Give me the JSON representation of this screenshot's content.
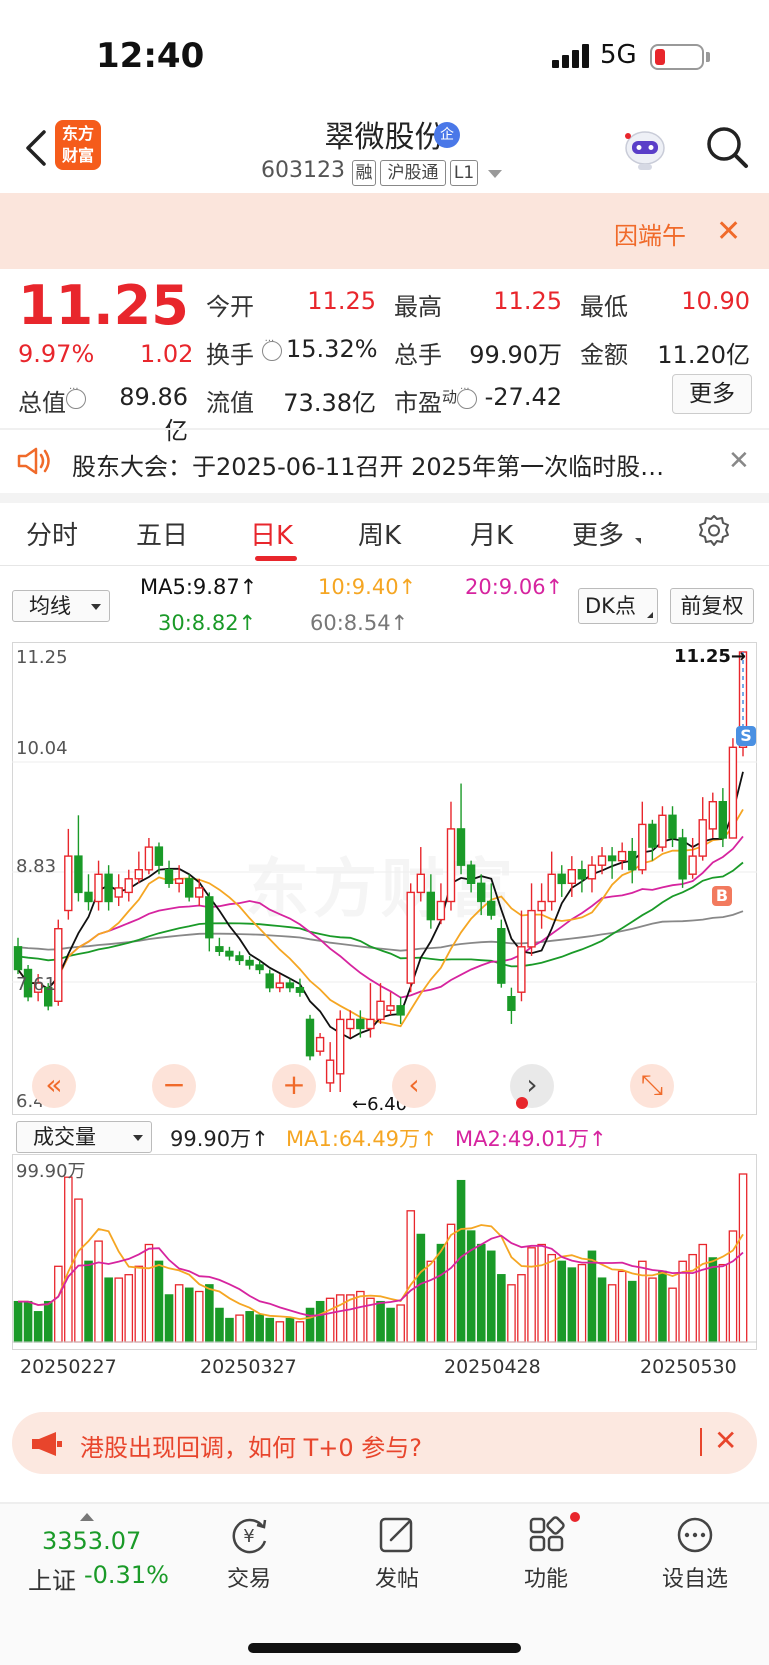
{
  "status": {
    "time": "12:40",
    "network": "5G"
  },
  "header": {
    "logo": "东方财富",
    "name": "翠微股份",
    "name_badge": "企",
    "code": "603123",
    "tags": [
      "融",
      "沪股通",
      "L1"
    ]
  },
  "banner": {
    "text": "因端午"
  },
  "quote": {
    "price": "11.25",
    "pct": "9.97%",
    "chg": "1.02",
    "open_label": "今开",
    "open": "11.25",
    "high_label": "最高",
    "high": "11.25",
    "low_label": "最低",
    "low": "10.90",
    "turnover_label": "换手",
    "turnover": "15.32%",
    "volume_label": "总手",
    "volume": "99.90万",
    "amount_label": "金额",
    "amount": "11.20亿",
    "mktcap_label": "总值",
    "mktcap": "89.86亿",
    "float_label": "流值",
    "float": "73.38亿",
    "pe_label": "市盈",
    "pe_sup": "动",
    "pe": "-27.42",
    "more": "更多"
  },
  "announcement": {
    "text": "股东大会：于2025-06-11召开 2025年第一次临时股…"
  },
  "tabs": [
    "分时",
    "五日",
    "日K",
    "周K",
    "月K",
    "更多"
  ],
  "ma_bar": {
    "selector": "均线",
    "ma5": "MA5:9.87↑",
    "ma10": "10:9.40↑",
    "ma20": "20:9.06↑",
    "ma30": "30:8.82↑",
    "ma60": "60:8.54↑",
    "dk": "DK点",
    "fuquan": "前复权"
  },
  "kline": {
    "price_axis": [
      "11.25",
      "10.04",
      "8.83",
      "7.61",
      "6.40"
    ],
    "max_label": "11.25→",
    "min_label": "←6.40",
    "markers": {
      "sell": "S",
      "buy": "B"
    },
    "watermark": "东方财富"
  },
  "volume_bar": {
    "selector": "成交量",
    "vol": "99.90万↑",
    "ma1": "MA1:64.49万↑",
    "ma2": "MA2:49.01万↑",
    "axis_top": "99.90万",
    "dates": [
      "20250227",
      "20250327",
      "20250428",
      "20250530"
    ]
  },
  "controls": [
    "«",
    "−",
    "+",
    "‹",
    "›",
    "⤡"
  ],
  "ad": {
    "text": "港股出现回调，如何 T+0 参与?"
  },
  "bottom_nav": {
    "index_value": "3353.07",
    "index_name": "上证",
    "index_chg": "-0.31%",
    "items": [
      "交易",
      "发帖",
      "功能",
      "设自选"
    ]
  },
  "colors": {
    "up": "#e8262c",
    "down": "#1a9a28",
    "ma5": "#111111",
    "ma10": "#f5a623",
    "ma20": "#d6249f",
    "ma30": "#1a9a28",
    "ma60": "#888888"
  },
  "chart_data": {
    "type": "candlestick",
    "x_start": "20250219",
    "x_end": "20250530",
    "ylim": [
      6.4,
      11.25
    ],
    "candles": [
      [
        8.0,
        7.75,
        8.1,
        7.7
      ],
      [
        7.75,
        7.45,
        7.8,
        7.4
      ],
      [
        7.5,
        7.6,
        7.7,
        7.4
      ],
      [
        7.55,
        7.35,
        7.6,
        7.3
      ],
      [
        7.4,
        8.2,
        8.3,
        7.35
      ],
      [
        8.4,
        9.0,
        9.3,
        8.3
      ],
      [
        9.0,
        8.6,
        9.45,
        8.5
      ],
      [
        8.6,
        8.5,
        8.8,
        8.4
      ],
      [
        8.5,
        8.8,
        8.95,
        8.4
      ],
      [
        8.8,
        8.5,
        8.9,
        8.4
      ],
      [
        8.55,
        8.65,
        8.8,
        8.45
      ],
      [
        8.6,
        8.75,
        8.85,
        8.5
      ],
      [
        8.75,
        8.85,
        9.05,
        8.7
      ],
      [
        8.85,
        9.1,
        9.2,
        8.8
      ],
      [
        9.1,
        8.9,
        9.15,
        8.8
      ],
      [
        8.85,
        8.7,
        8.95,
        8.65
      ],
      [
        8.7,
        8.75,
        8.9,
        8.6
      ],
      [
        8.75,
        8.55,
        8.8,
        8.5
      ],
      [
        8.55,
        8.65,
        8.75,
        8.45
      ],
      [
        8.55,
        8.1,
        8.6,
        7.95
      ],
      [
        8.0,
        7.95,
        8.1,
        7.9
      ],
      [
        7.95,
        7.9,
        8.0,
        7.85
      ],
      [
        7.9,
        7.85,
        7.95,
        7.8
      ],
      [
        7.85,
        7.8,
        7.9,
        7.75
      ],
      [
        7.8,
        7.75,
        7.85,
        7.7
      ],
      [
        7.7,
        7.55,
        7.75,
        7.5
      ],
      [
        7.55,
        7.6,
        7.7,
        7.5
      ],
      [
        7.6,
        7.55,
        7.65,
        7.5
      ],
      [
        7.55,
        7.5,
        7.65,
        7.45
      ],
      [
        7.2,
        6.8,
        7.25,
        6.75
      ],
      [
        6.85,
        7.0,
        7.05,
        6.8
      ],
      [
        6.5,
        6.75,
        6.95,
        6.4
      ],
      [
        6.6,
        7.2,
        7.3,
        6.4
      ],
      [
        7.1,
        7.2,
        7.3,
        7.0
      ],
      [
        7.2,
        7.1,
        7.3,
        7.0
      ],
      [
        7.1,
        7.2,
        7.6,
        7.0
      ],
      [
        7.2,
        7.4,
        7.6,
        7.15
      ],
      [
        7.3,
        7.35,
        7.5,
        7.25
      ],
      [
        7.35,
        7.25,
        7.45,
        7.15
      ],
      [
        7.6,
        8.6,
        8.7,
        7.5
      ],
      [
        8.6,
        8.8,
        9.1,
        8.5
      ],
      [
        8.6,
        8.3,
        8.8,
        8.2
      ],
      [
        8.3,
        8.5,
        8.7,
        8.25
      ],
      [
        8.5,
        9.3,
        9.6,
        8.4
      ],
      [
        9.3,
        8.9,
        9.8,
        8.8
      ],
      [
        8.9,
        8.7,
        8.95,
        8.6
      ],
      [
        8.7,
        8.5,
        8.8,
        8.35
      ],
      [
        8.5,
        8.35,
        8.7,
        8.3
      ],
      [
        8.2,
        7.6,
        8.3,
        7.55
      ],
      [
        7.45,
        7.3,
        7.55,
        7.15
      ],
      [
        7.5,
        8.0,
        8.4,
        7.4
      ],
      [
        8.0,
        8.4,
        8.7,
        7.9
      ],
      [
        8.4,
        8.5,
        8.7,
        8.2
      ],
      [
        8.5,
        8.8,
        9.05,
        8.4
      ],
      [
        8.8,
        8.7,
        8.9,
        8.55
      ],
      [
        8.7,
        8.85,
        9.0,
        8.55
      ],
      [
        8.85,
        8.75,
        8.95,
        8.6
      ],
      [
        8.75,
        8.9,
        9.0,
        8.6
      ],
      [
        8.9,
        9.0,
        9.1,
        8.8
      ],
      [
        9.0,
        8.95,
        9.1,
        8.75
      ],
      [
        8.95,
        9.05,
        9.15,
        8.85
      ],
      [
        9.05,
        8.85,
        9.2,
        8.7
      ],
      [
        8.85,
        9.35,
        9.6,
        8.8
      ],
      [
        9.35,
        9.1,
        9.4,
        8.95
      ],
      [
        9.1,
        9.45,
        9.55,
        9.05
      ],
      [
        9.45,
        9.2,
        9.55,
        9.1
      ],
      [
        9.2,
        8.75,
        9.3,
        8.65
      ],
      [
        8.8,
        9.0,
        9.2,
        8.75
      ],
      [
        9.0,
        9.4,
        9.65,
        8.95
      ],
      [
        9.3,
        9.6,
        9.7,
        9.2
      ],
      [
        9.6,
        9.2,
        9.75,
        9.1
      ],
      [
        9.2,
        10.2,
        10.3,
        9.2
      ],
      [
        10.2,
        11.25,
        11.25,
        10.1
      ]
    ],
    "volume_max_wan": 99.9,
    "volumes": [
      [
        24,
        0
      ],
      [
        24,
        0
      ],
      [
        18,
        0
      ],
      [
        24,
        0
      ],
      [
        45,
        1
      ],
      [
        98,
        1
      ],
      [
        85,
        1
      ],
      [
        48,
        0
      ],
      [
        60,
        1
      ],
      [
        38,
        0
      ],
      [
        38,
        1
      ],
      [
        40,
        1
      ],
      [
        45,
        1
      ],
      [
        58,
        1
      ],
      [
        48,
        0
      ],
      [
        28,
        0
      ],
      [
        34,
        1
      ],
      [
        32,
        0
      ],
      [
        30,
        1
      ],
      [
        34,
        0
      ],
      [
        20,
        0
      ],
      [
        14,
        0
      ],
      [
        16,
        1
      ],
      [
        18,
        0
      ],
      [
        16,
        0
      ],
      [
        14,
        0
      ],
      [
        12,
        1
      ],
      [
        14,
        0
      ],
      [
        12,
        1
      ],
      [
        20,
        0
      ],
      [
        24,
        0
      ],
      [
        26,
        1
      ],
      [
        28,
        1
      ],
      [
        28,
        1
      ],
      [
        30,
        1
      ],
      [
        26,
        1
      ],
      [
        24,
        0
      ],
      [
        20,
        0
      ],
      [
        22,
        1
      ],
      [
        78,
        1
      ],
      [
        64,
        0
      ],
      [
        48,
        1
      ],
      [
        58,
        0
      ],
      [
        70,
        1
      ],
      [
        96,
        0
      ],
      [
        66,
        0
      ],
      [
        58,
        0
      ],
      [
        54,
        0
      ],
      [
        40,
        0
      ],
      [
        34,
        1
      ],
      [
        40,
        1
      ],
      [
        56,
        1
      ],
      [
        58,
        1
      ],
      [
        52,
        1
      ],
      [
        48,
        0
      ],
      [
        44,
        0
      ],
      [
        46,
        1
      ],
      [
        54,
        0
      ],
      [
        38,
        0
      ],
      [
        34,
        1
      ],
      [
        42,
        1
      ],
      [
        36,
        0
      ],
      [
        48,
        1
      ],
      [
        38,
        1
      ],
      [
        42,
        0
      ],
      [
        32,
        1
      ],
      [
        48,
        1
      ],
      [
        52,
        1
      ],
      [
        58,
        1
      ],
      [
        50,
        0
      ],
      [
        46,
        1
      ],
      [
        66,
        1
      ],
      [
        99.9,
        1
      ]
    ],
    "ma_lines": {
      "ma5": "MA5",
      "ma10": "MA10",
      "ma20": "MA20",
      "ma30": "MA30",
      "ma60": "MA60"
    }
  }
}
